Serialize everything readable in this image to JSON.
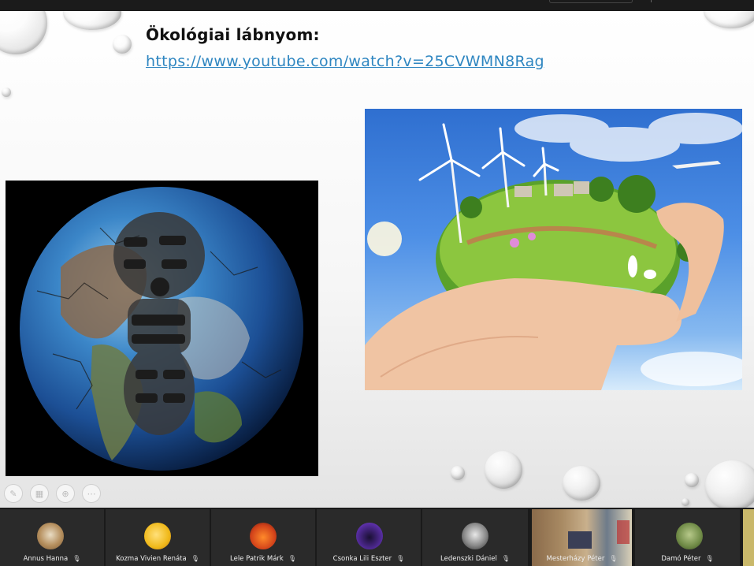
{
  "slide": {
    "title": "Ökológiai lábnyom:",
    "link": "https://www.youtube.com/watch?v=25CVWMN8Rag"
  },
  "toolbar_icons": [
    "pen-icon",
    "grid-icon",
    "zoom-icon",
    "more-icon"
  ],
  "participants": [
    {
      "name": "Annus Hanna",
      "avatar": "dog-avatar",
      "muted": true
    },
    {
      "name": "Kozma Vivien Renáta",
      "avatar": "cartoon-avatar",
      "muted": true
    },
    {
      "name": "Lele Patrik Márk",
      "avatar": "car-avatar",
      "muted": true
    },
    {
      "name": "Csonka Lili Eszter",
      "avatar": "cat-avatar",
      "muted": true
    },
    {
      "name": "Ledenszki Dániel",
      "avatar": "raccoon-avatar",
      "muted": true
    },
    {
      "name": "Mesterházy Péter",
      "avatar": "video-feed",
      "muted": true
    },
    {
      "name": "Damó Péter",
      "avatar": "frog-avatar",
      "muted": true
    }
  ],
  "colors": {
    "link": "#2e86c1",
    "strip_background": "#1a1a1a",
    "tile_background": "#2a2a2a"
  }
}
